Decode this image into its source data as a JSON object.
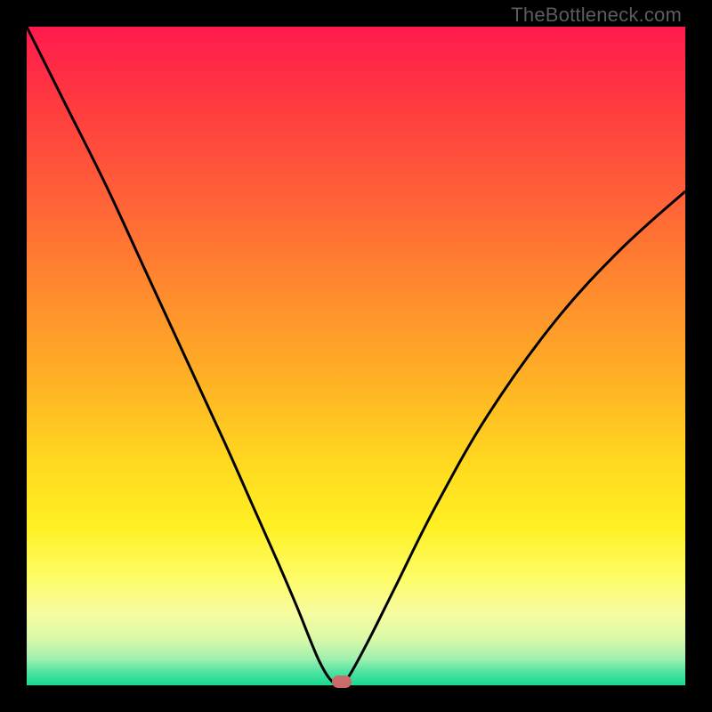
{
  "watermark": "TheBottleneck.com",
  "colors": {
    "frame": "#000000",
    "curve": "#000000",
    "marker": "#cc6a6a"
  },
  "chart_data": {
    "type": "line",
    "title": "",
    "xlabel": "",
    "ylabel": "",
    "xlim": [
      0,
      100
    ],
    "ylim": [
      0,
      100
    ],
    "series": [
      {
        "name": "bottleneck-curve",
        "x": [
          0,
          6,
          12,
          18,
          24,
          30,
          34,
          38,
          41,
          43,
          44.5,
          46,
          47.5,
          49,
          52,
          56,
          62,
          70,
          80,
          90,
          100
        ],
        "y": [
          100,
          88,
          76,
          63,
          50,
          37,
          28,
          19,
          12,
          7,
          3.5,
          1,
          0,
          1.5,
          7,
          15,
          27,
          41,
          55,
          66,
          75
        ]
      }
    ],
    "marker": {
      "x": 47.8,
      "y": 0.5
    },
    "gradient_stops": [
      {
        "pos": 0,
        "color": "#ff1a4d"
      },
      {
        "pos": 50,
        "color": "#ffb224"
      },
      {
        "pos": 82,
        "color": "#fdfd6a"
      },
      {
        "pos": 100,
        "color": "#19d98f"
      }
    ]
  }
}
